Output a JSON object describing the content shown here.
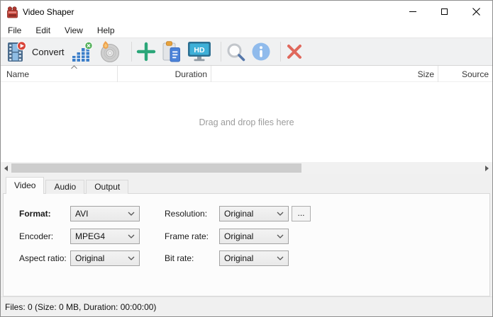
{
  "window": {
    "title": "Video Shaper",
    "controls": [
      "minimize",
      "maximize",
      "close"
    ]
  },
  "menu": {
    "items": [
      "File",
      "Edit",
      "View",
      "Help"
    ]
  },
  "toolbar": {
    "convert_label": "Convert",
    "hd_text": "HD",
    "buttons": [
      {
        "icon": "film-convert-icon",
        "label": "Convert"
      },
      {
        "icon": "audio-levels-icon"
      },
      {
        "icon": "burn-disc-icon"
      },
      {
        "icon": "add-files-icon"
      },
      {
        "icon": "paste-icon"
      },
      {
        "icon": "hd-display-icon"
      },
      {
        "icon": "search-icon"
      },
      {
        "icon": "info-icon"
      },
      {
        "icon": "remove-icon"
      }
    ]
  },
  "file_list": {
    "columns": [
      "Name",
      "Duration",
      "Size",
      "Source"
    ],
    "sort": {
      "column": "Name",
      "direction": "ascending"
    },
    "placeholder": "Drag and drop files here",
    "rows": []
  },
  "tabs": {
    "items": [
      "Video",
      "Audio",
      "Output"
    ],
    "active": "Video"
  },
  "video_tab": {
    "fields_left": [
      {
        "label": "Format:",
        "value": "AVI"
      },
      {
        "label": "Encoder:",
        "value": "MPEG4"
      },
      {
        "label": "Aspect ratio:",
        "value": "Original"
      }
    ],
    "fields_right": [
      {
        "label": "Resolution:",
        "value": "Original"
      },
      {
        "label": "Frame rate:",
        "value": "Original"
      },
      {
        "label": "Bit rate:",
        "value": "Original"
      }
    ],
    "resolution_browse_label": "..."
  },
  "statusbar": {
    "text": "Files: 0 (Size: 0 MB, Duration: 00:00:00)"
  }
}
